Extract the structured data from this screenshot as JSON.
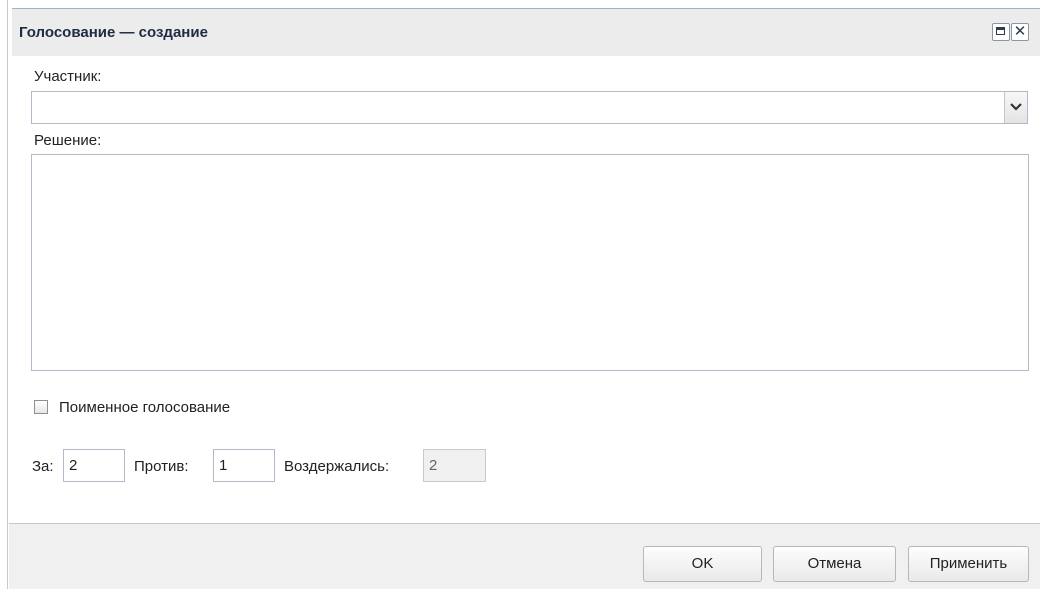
{
  "dialog": {
    "title": "Голосование — создание"
  },
  "form": {
    "participant_label": "Участник:",
    "participant_value": "",
    "decision_label": "Решение:",
    "decision_value": "",
    "rollcall_label": "Поименное голосование",
    "rollcall_checked": false,
    "for_label": "За:",
    "for_value": "2",
    "against_label": "Против:",
    "against_value": "1",
    "abstained_label": "Воздержались:",
    "abstained_value": "2"
  },
  "buttons": {
    "ok": "OK",
    "cancel": "Отмена",
    "apply": "Применить"
  }
}
